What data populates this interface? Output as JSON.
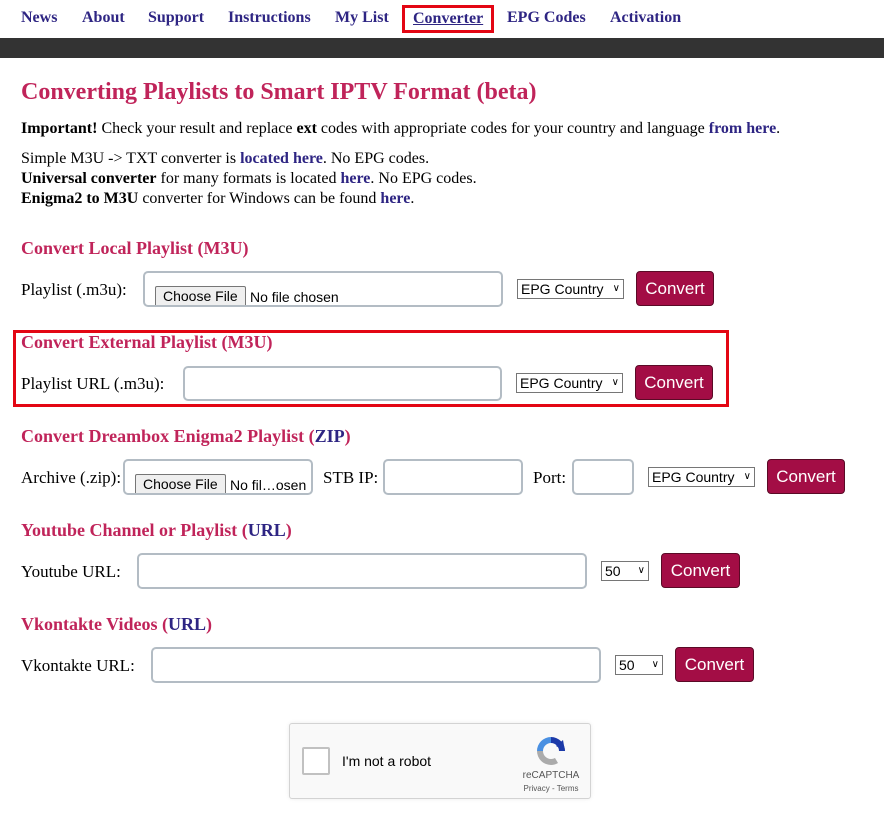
{
  "nav": {
    "items": [
      {
        "label": "News"
      },
      {
        "label": "About"
      },
      {
        "label": "Support"
      },
      {
        "label": "Instructions"
      },
      {
        "label": "My List"
      },
      {
        "label": "Converter",
        "active": true
      },
      {
        "label": "EPG Codes"
      },
      {
        "label": "Activation"
      }
    ]
  },
  "page": {
    "title": "Converting Playlists to Smart IPTV Format (beta)",
    "important": {
      "bold": "Important!",
      "text1": " Check your result and replace ",
      "ext": "ext",
      "text2": " codes with appropriate codes for your country and language ",
      "link": "from here",
      "end": "."
    },
    "line1": {
      "text1": "Simple M3U -> TXT converter is ",
      "link": "located here",
      "text2": ". No EPG codes."
    },
    "line2": {
      "bold": "Universal converter",
      "text1": " for many formats is located ",
      "link": "here",
      "text2": ". No EPG codes."
    },
    "line3": {
      "bold": "Enigma2 to M3U",
      "text1": " converter for Windows can be found ",
      "link": "here",
      "text2": "."
    }
  },
  "sections": {
    "local": {
      "title": "Convert Local Playlist (M3U)",
      "label": "Playlist (.m3u):",
      "file_button": "Choose File",
      "file_status": "No file chosen",
      "epg_select": "EPG Country",
      "button": "Convert"
    },
    "external": {
      "title": "Convert External Playlist (M3U)",
      "label": "Playlist URL (.m3u):",
      "input_value": "",
      "epg_select": "EPG Country",
      "button": "Convert"
    },
    "dreambox": {
      "title_pre": "Convert Dreambox Enigma2 Playlist (",
      "title_link": "ZIP",
      "title_post": ")",
      "label": "Archive (.zip):",
      "file_button": "Choose File",
      "file_status": "No fil…osen",
      "stb_label": "STB IP:",
      "stb_value": "",
      "port_label": "Port:",
      "port_value": "",
      "epg_select": "EPG Country",
      "button": "Convert"
    },
    "youtube": {
      "title_pre": "Youtube Channel or Playlist (",
      "title_link": "URL",
      "title_post": ")",
      "label": "Youtube URL:",
      "input_value": "",
      "count_select": "50",
      "button": "Convert"
    },
    "vk": {
      "title_pre": "Vkontakte Videos (",
      "title_link": "URL",
      "title_post": ")",
      "label": "Vkontakte URL:",
      "input_value": "",
      "count_select": "50",
      "button": "Convert"
    }
  },
  "captcha": {
    "label": "I'm not a robot",
    "brand": "reCAPTCHA",
    "privacy": "Privacy",
    "sep": " - ",
    "terms": "Terms"
  },
  "colors": {
    "nav_link": "#2e2583",
    "heading": "#c0245a",
    "button": "#a30d45",
    "highlight": "#e30613",
    "dark_bar": "#333333"
  }
}
